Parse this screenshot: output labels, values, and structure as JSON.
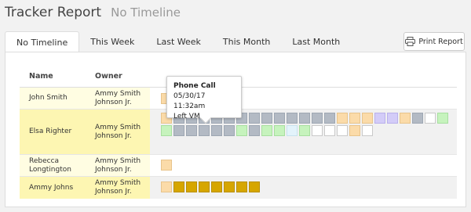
{
  "header": {
    "title": "Tracker Report",
    "subtitle": "No Timeline"
  },
  "tabs": [
    {
      "label": "No Timeline",
      "active": true
    },
    {
      "label": "This Week",
      "active": false
    },
    {
      "label": "Last Week",
      "active": false
    },
    {
      "label": "This Month",
      "active": false
    },
    {
      "label": "Last Month",
      "active": false
    }
  ],
  "print_button": {
    "label": "Print Report",
    "icon": "printer-icon"
  },
  "table": {
    "columns": {
      "name": "Name",
      "owner": "Owner"
    },
    "rows": [
      {
        "name": "John Smith",
        "owner": "Ammy Smith Johnson Jr.",
        "cells": [
          "peach"
        ]
      },
      {
        "name": "Elsa Righter",
        "owner": "Ammy Smith Johnson Jr.",
        "cells": [
          "peach",
          "gray",
          "gray",
          "gray",
          "gray",
          "gray",
          "gray",
          "gray",
          "gray",
          "gray",
          "gray",
          "gray",
          "gray",
          "gray",
          "peach",
          "peach",
          "peach",
          "lilac",
          "lilac",
          "peach",
          "gray",
          "white",
          "green",
          "green",
          "gray",
          "gray",
          "gray",
          "gray",
          "gray",
          "green",
          "gray",
          "green",
          "green",
          "blue",
          "green",
          "white",
          "white",
          "white",
          "peach",
          "white"
        ]
      },
      {
        "name": "Rebecca Longtington",
        "owner": "Ammy Smith Johnson Jr.",
        "cells": [
          "peach"
        ]
      },
      {
        "name": "Ammy Johns",
        "owner": "Ammy Smith Johnson Jr.",
        "cells": [
          "peach",
          "gold",
          "gold",
          "gold",
          "gold",
          "gold",
          "gold",
          "gold"
        ]
      }
    ]
  },
  "cell_colors": {
    "peach": "#fbdba9",
    "gray": "#b3bac4",
    "green": "#c6f3bd",
    "lilac": "#d3ccf8",
    "blue": "#e3f3fb",
    "white": "#ffffff",
    "gold": "#d6a600"
  },
  "tooltip": {
    "title": "Phone Call",
    "datetime": "05/30/17 11:32am",
    "detail": "Left VM"
  }
}
